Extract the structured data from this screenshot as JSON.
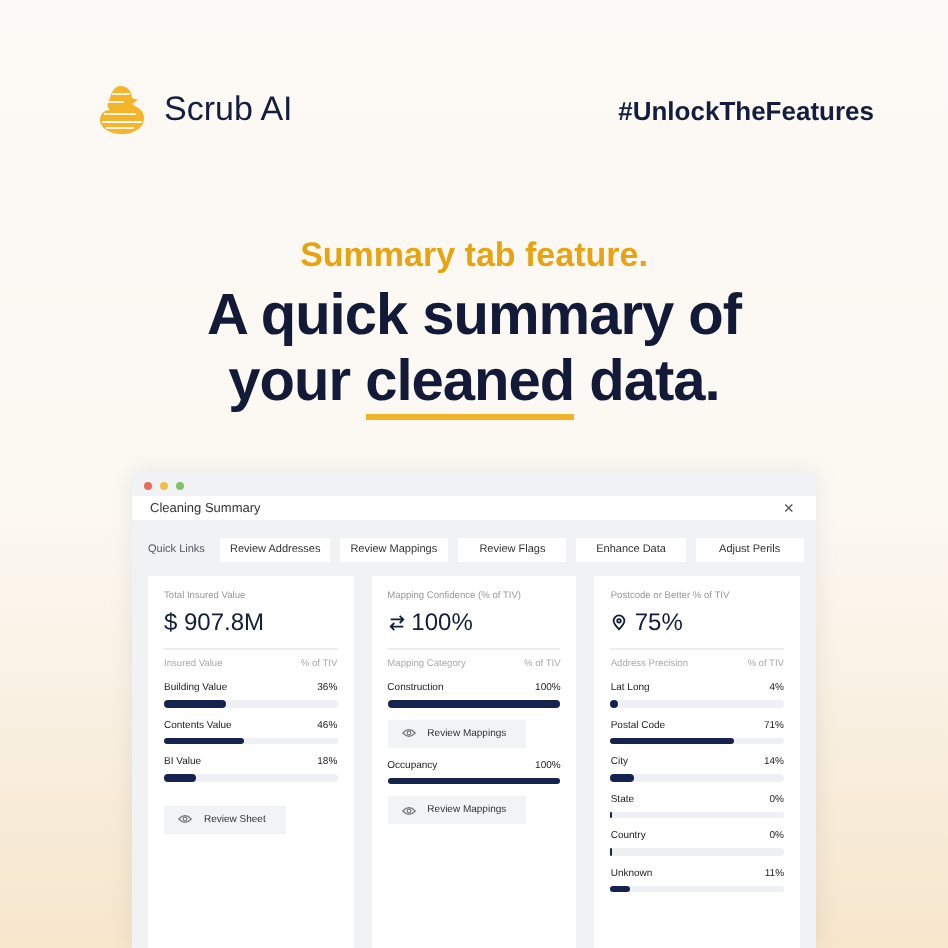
{
  "brand": {
    "name": "Scrub AI"
  },
  "hashtag": "#UnlockTheFeatures",
  "headline": {
    "kicker": "Summary tab feature.",
    "lines": [
      "A quick summary of",
      "your **cleaned** data."
    ]
  },
  "window": {
    "title": "Cleaning Summary",
    "close": "×",
    "quick_links": {
      "label": "Quick Links",
      "links": [
        "Review Addresses",
        "Review Mappings",
        "Review Flags",
        "Enhance Data",
        "Adjust Perils"
      ]
    },
    "cards": [
      {
        "kind": "plain",
        "label": "Total Insured Value",
        "value": "$ 907.8M",
        "column_left": "Insured Value",
        "column_right": "% of TIV",
        "rows": [
          {
            "name": "Building Value",
            "percent": "36%",
            "level": 0.36
          },
          {
            "name": "Contents Value",
            "percent": "46%",
            "level": 0.46
          },
          {
            "name": "BI Value",
            "percent": "18%",
            "level": 0.18
          }
        ],
        "button": "Review Sheet"
      },
      {
        "kind": "mapping",
        "label": "Mapping Confidence (% of TIV)",
        "value": "100%",
        "column_left": "Mapping Category",
        "column_right": "% of TIV",
        "rows": [
          {
            "name": "Construction",
            "percent": "100%",
            "level": 1,
            "action": "Review Mappings"
          },
          {
            "name": "Occupancy",
            "percent": "100%",
            "level": 1,
            "action": "Review Mappings"
          }
        ]
      },
      {
        "kind": "location",
        "label": "Postcode or Better % of TIV",
        "value": "75%",
        "column_left": "Address Precision",
        "column_right": "% of TIV",
        "rows": [
          {
            "name": "Lat Long",
            "percent": "4%",
            "level": 0.04
          },
          {
            "name": "Postal Code",
            "percent": "71%",
            "level": 0.71
          },
          {
            "name": "City",
            "percent": "14%",
            "level": 0.14
          },
          {
            "name": "State",
            "percent": "0%",
            "level": 0
          },
          {
            "name": "Country",
            "percent": "0%",
            "level": 0
          },
          {
            "name": "Unknown",
            "percent": "11%",
            "level": 0.11
          }
        ]
      }
    ]
  }
}
